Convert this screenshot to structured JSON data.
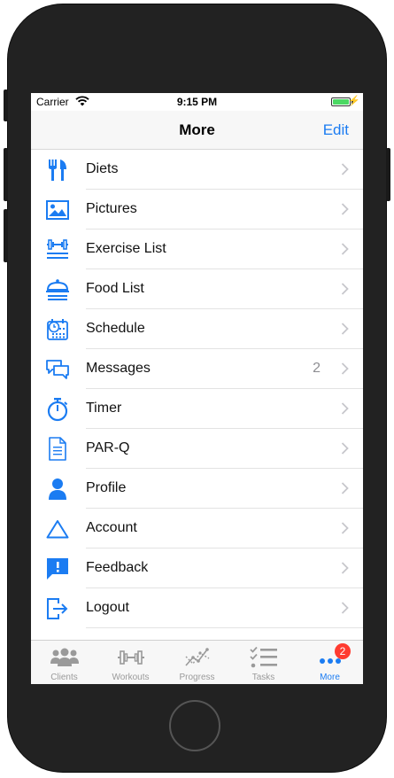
{
  "status": {
    "carrier": "Carrier",
    "time": "9:15 PM"
  },
  "nav": {
    "title": "More",
    "edit_label": "Edit"
  },
  "items": [
    {
      "label": "Diets",
      "icon": "fork-knife-icon"
    },
    {
      "label": "Pictures",
      "icon": "picture-icon"
    },
    {
      "label": "Exercise List",
      "icon": "dumbbell-list-icon"
    },
    {
      "label": "Food List",
      "icon": "food-cloche-icon"
    },
    {
      "label": "Schedule",
      "icon": "calendar-clock-icon"
    },
    {
      "label": "Messages",
      "icon": "chat-bubbles-icon",
      "count": "2"
    },
    {
      "label": "Timer",
      "icon": "stopwatch-icon"
    },
    {
      "label": "PAR-Q",
      "icon": "document-icon"
    },
    {
      "label": "Profile",
      "icon": "person-icon"
    },
    {
      "label": "Account",
      "icon": "triangle-icon"
    },
    {
      "label": "Feedback",
      "icon": "feedback-icon"
    },
    {
      "label": "Logout",
      "icon": "logout-icon"
    }
  ],
  "tabs": [
    {
      "label": "Clients",
      "icon": "clients-icon"
    },
    {
      "label": "Workouts",
      "icon": "dumbbell-icon"
    },
    {
      "label": "Progress",
      "icon": "progress-chart-icon"
    },
    {
      "label": "Tasks",
      "icon": "checklist-icon"
    },
    {
      "label": "More",
      "icon": "more-dots-icon",
      "badge": "2",
      "active": true
    }
  ],
  "colors": {
    "accent": "#1b7cf2",
    "badge": "#ff3b30",
    "battery": "#4cd964"
  }
}
